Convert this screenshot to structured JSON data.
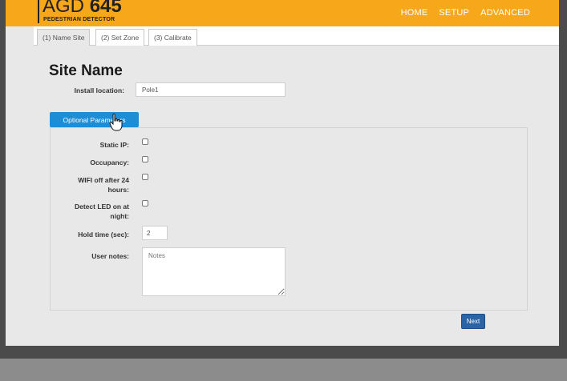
{
  "header": {
    "brand_main": "AGD",
    "brand_number": "645",
    "brand_subtitle": "PEDESTRIAN DETECTOR",
    "nav": [
      "HOME",
      "SETUP",
      "ADVANCED"
    ]
  },
  "tabs": [
    "(1) Name Site",
    "(2) Set Zone",
    "(3) Calibrate"
  ],
  "page": {
    "title": "Site Name",
    "install_label": "Install location:",
    "install_value": "Pole1",
    "optional_button": "Optional Parameters"
  },
  "params": {
    "static_ip_label": "Static IP:",
    "occupancy_label": "Occupancy:",
    "wifi_label_1": "WIFI off after 24",
    "wifi_label_2": "hours:",
    "led_label_1": "Detect LED on at",
    "led_label_2": "night:",
    "hold_label": "Hold time (sec):",
    "hold_value": "2",
    "notes_label": "User notes:",
    "notes_placeholder": "Notes"
  },
  "footer": {
    "next_label": "Next"
  },
  "colors": {
    "topbar": "#f7a81a",
    "primary_button": "#1d8ed6",
    "next_button": "#2a63a6"
  }
}
